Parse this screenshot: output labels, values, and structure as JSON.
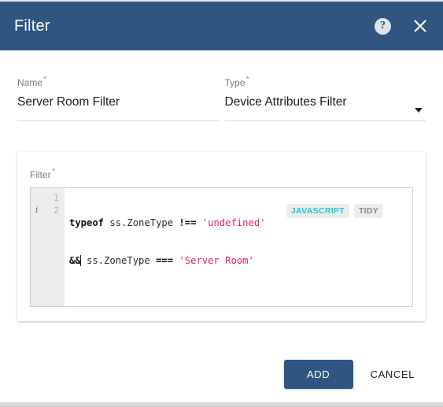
{
  "window": {
    "title": "Filter",
    "help_icon": "help-circle-icon",
    "close_icon": "close-icon",
    "header_color": "#2f5580"
  },
  "form": {
    "name_field": {
      "label": "Name",
      "required_marker": "*",
      "value": "Server Room Filter",
      "placeholder": "Name"
    },
    "type_field": {
      "label": "Type",
      "required_marker": "*",
      "value": "Device Attributes Filter",
      "caret_icon": "chevron-down-icon",
      "options": [
        "Device Attributes Filter"
      ]
    }
  },
  "editor": {
    "label": "Filter",
    "required_marker": "*",
    "lines": [
      {
        "number": "1",
        "marker": "",
        "tokens": [
          {
            "type": "kw",
            "text": "typeof"
          },
          {
            "type": "plain",
            "text": " ss.ZoneType "
          },
          {
            "type": "op",
            "text": "!=="
          },
          {
            "type": "plain",
            "text": " "
          },
          {
            "type": "str",
            "text": "'undefined'"
          }
        ]
      },
      {
        "number": "2",
        "marker": "i",
        "tokens": [
          {
            "type": "op",
            "text": "&&"
          },
          {
            "type": "plain",
            "text": " ss.ZoneType "
          },
          {
            "type": "op",
            "text": "==="
          },
          {
            "type": "plain",
            "text": " "
          },
          {
            "type": "str",
            "text": "'Server Room'"
          }
        ]
      }
    ],
    "badges": [
      {
        "label": "JAVASCRIPT",
        "color": "#23c4d6"
      },
      {
        "label": "TIDY",
        "color": "#8a8a8a"
      }
    ],
    "string_color": "#e0245e"
  },
  "footer": {
    "primary_label": "ADD",
    "secondary_label": "CANCEL"
  }
}
